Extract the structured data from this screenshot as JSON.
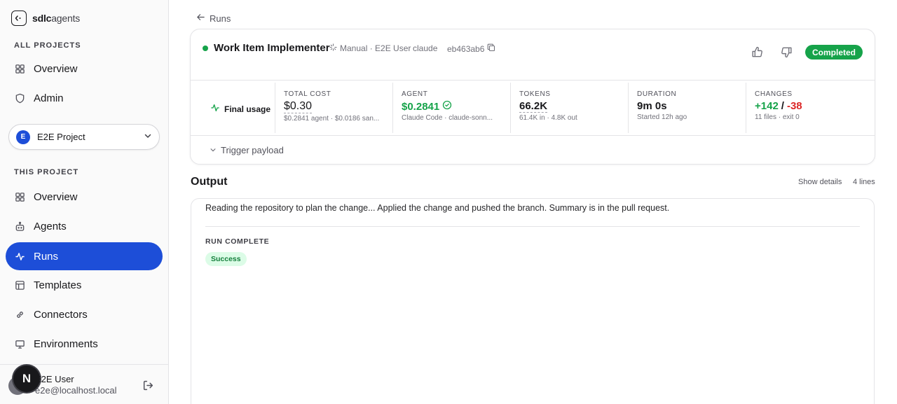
{
  "brand": {
    "name_bold": "sdlc",
    "name_light": "agents"
  },
  "sidebar": {
    "all_projects_label": "ALL PROJECTS",
    "global_items": [
      {
        "label": "Overview",
        "icon": "grid-icon"
      },
      {
        "label": "Admin",
        "icon": "shield-icon"
      }
    ],
    "project_select": {
      "badge": "E",
      "name": "E2E Project"
    },
    "this_project_label": "THIS PROJECT",
    "project_items": [
      {
        "label": "Overview",
        "icon": "grid-icon"
      },
      {
        "label": "Agents",
        "icon": "bot-icon"
      },
      {
        "label": "Runs",
        "icon": "activity-icon",
        "active": true
      },
      {
        "label": "Templates",
        "icon": "layout-icon"
      },
      {
        "label": "Connectors",
        "icon": "link-icon"
      },
      {
        "label": "Environments",
        "icon": "monitor-icon"
      }
    ],
    "user": {
      "badge": "N",
      "name": "E2E User",
      "email": "e2e@localhost.local"
    }
  },
  "breadcrumb": {
    "back_label": "Runs"
  },
  "run": {
    "title": "Work Item Implementer",
    "trigger_meta": "Manual · E2E User",
    "agent": "claude",
    "commit": "eb463ab6",
    "status": "Completed",
    "status_color": "#16a34a"
  },
  "stats": {
    "final_usage_label": "Final usage",
    "total_cost": {
      "label": "TOTAL COST",
      "value": "$0.30",
      "sub": "$0.2841 agent · $0.0186 san..."
    },
    "agent": {
      "label": "AGENT",
      "value": "$0.2841",
      "sub": "Claude Code · claude-sonn..."
    },
    "tokens": {
      "label": "TOKENS",
      "value": "66.2K",
      "sub": "61.4K in · 4.8K out"
    },
    "duration": {
      "label": "DURATION",
      "value": "9m 0s",
      "sub": "Started 12h ago"
    },
    "changes": {
      "label": "CHANGES",
      "added": "+142",
      "sep": "/",
      "removed": "-38",
      "sub": "11 files · exit 0"
    }
  },
  "trigger_payload_label": "Trigger payload",
  "output": {
    "title": "Output",
    "show_details": "Show details",
    "line_count": "4 lines",
    "text": "Reading the repository to plan the change... Applied the change and pushed the branch. Summary is in the pull request.",
    "complete_label": "RUN COMPLETE",
    "result": "Success"
  }
}
